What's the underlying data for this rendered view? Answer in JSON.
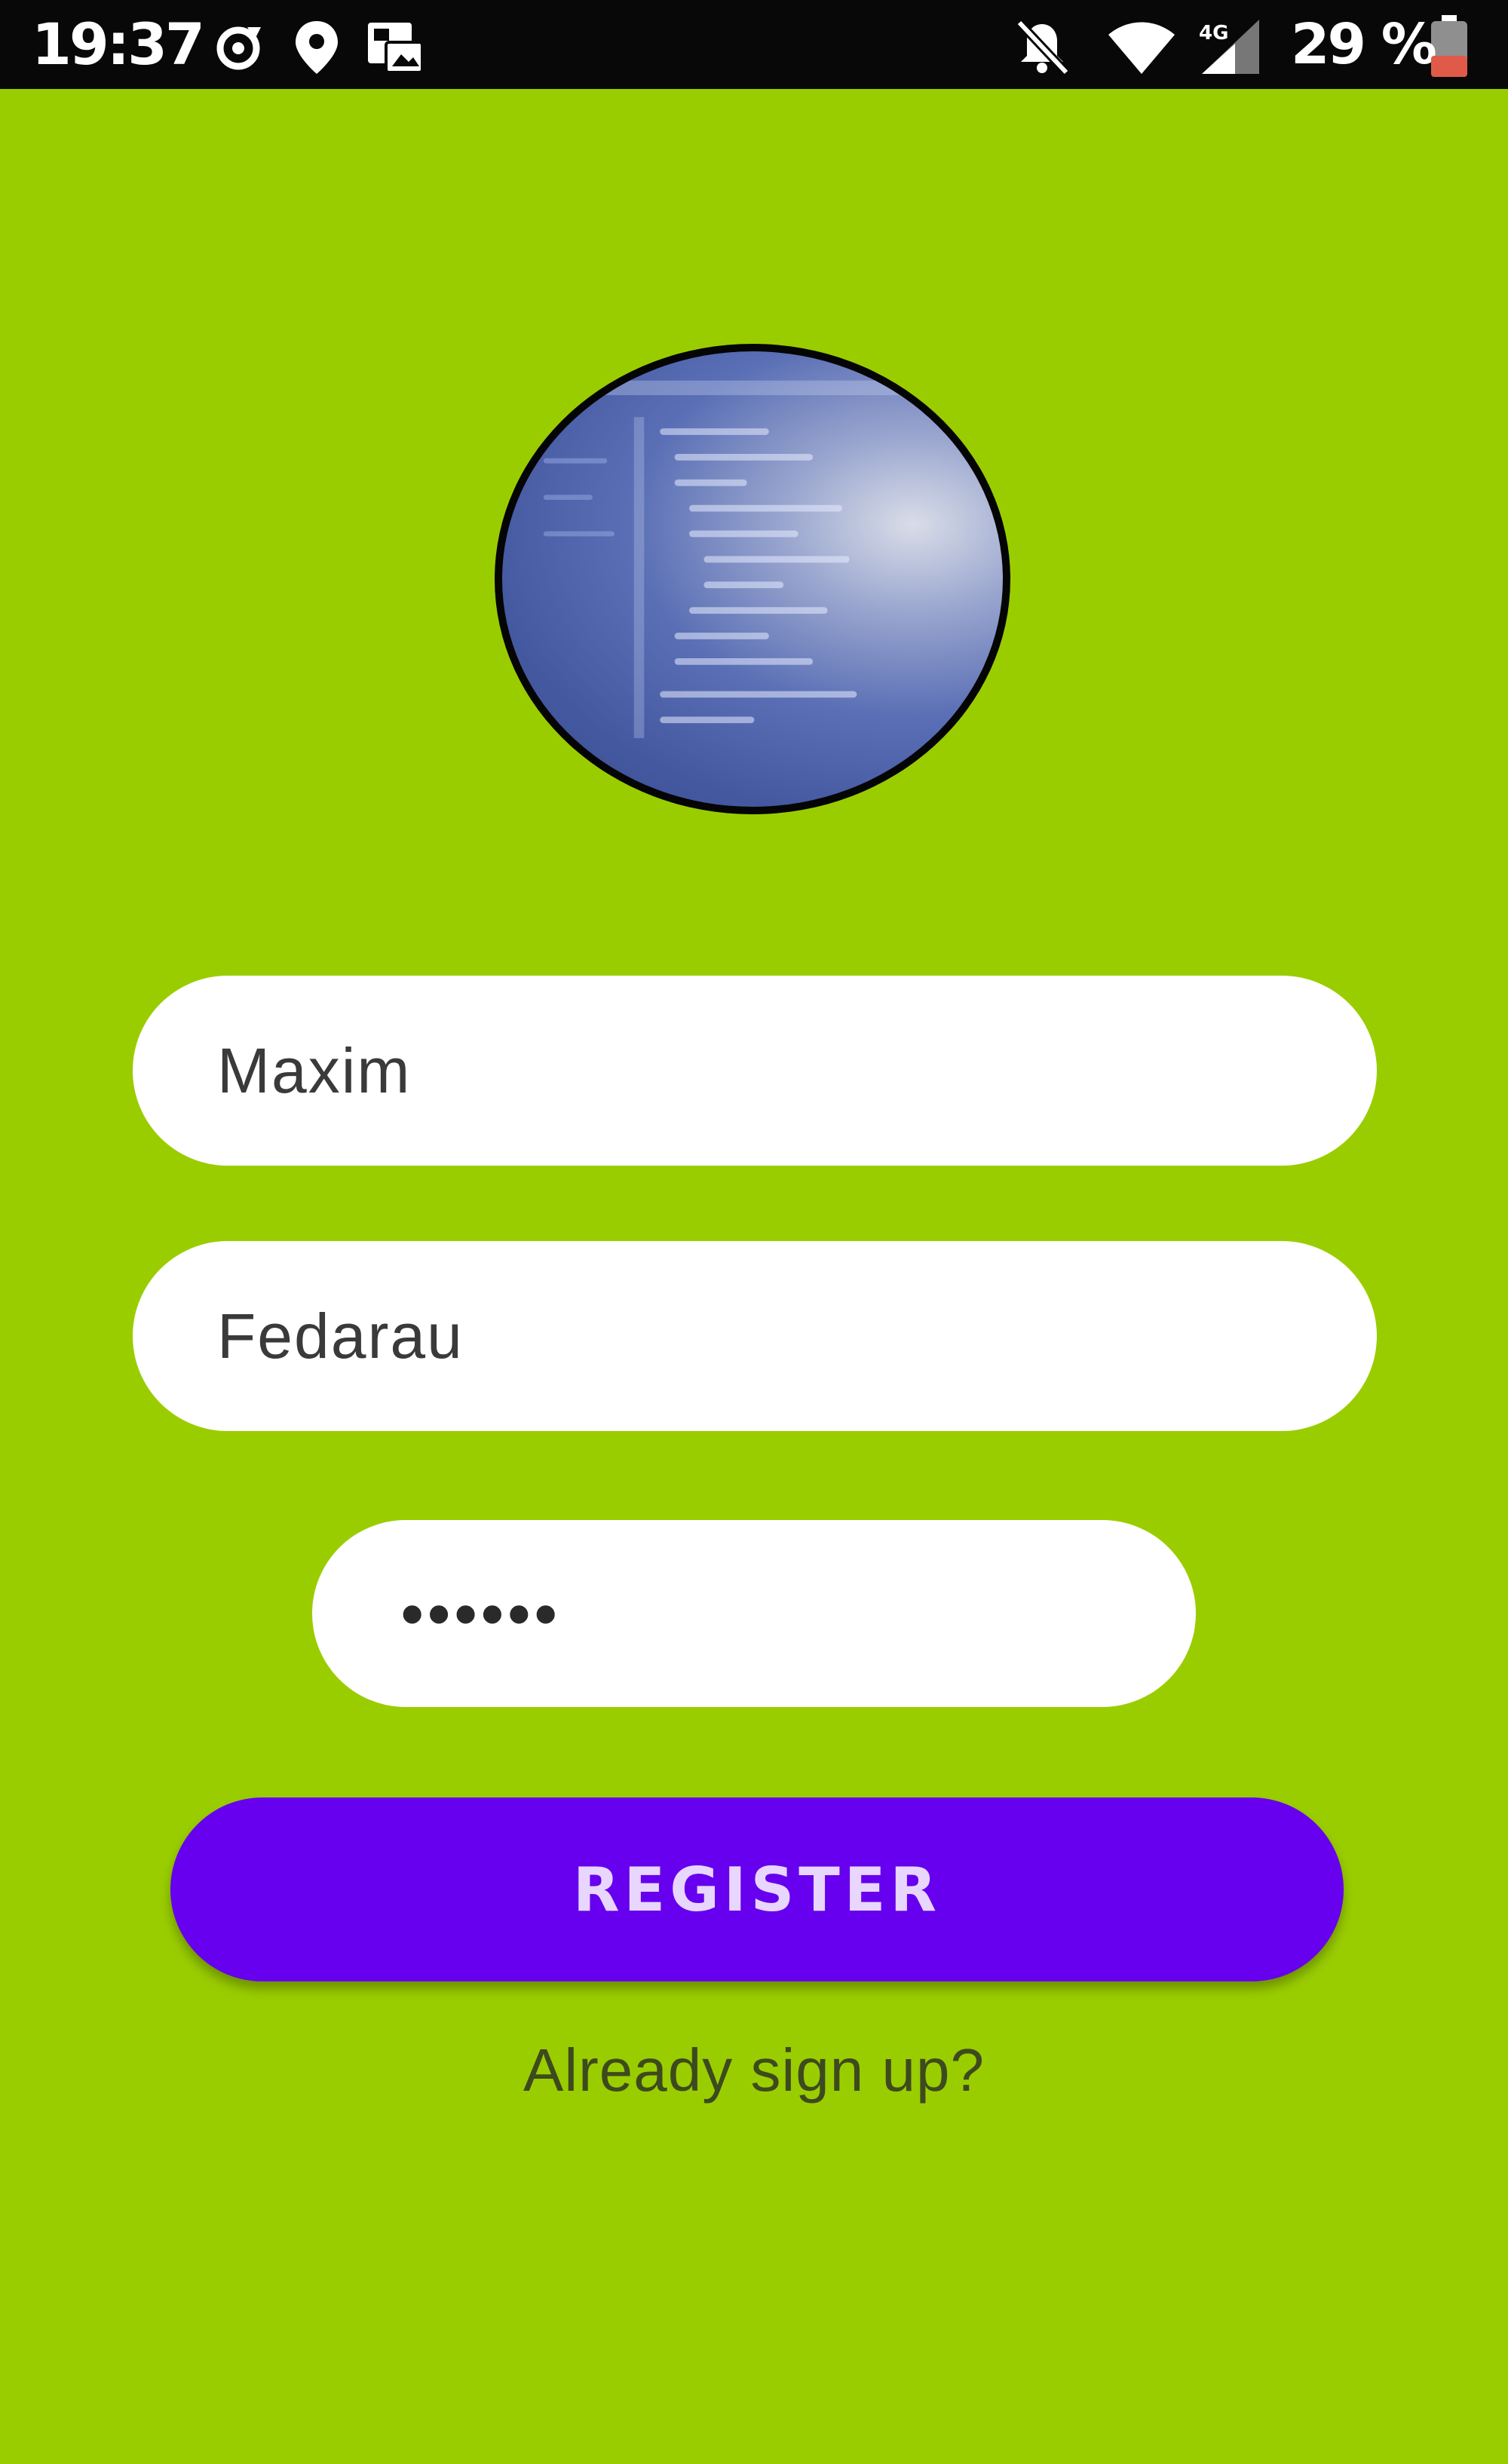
{
  "status_bar": {
    "time": "19:37",
    "battery_percent": "29 %",
    "icons": [
      "sync-icon",
      "location-icon",
      "gallery-icon",
      "mute-icon",
      "wifi-icon",
      "signal-icon",
      "battery-icon"
    ]
  },
  "colors": {
    "background": "#9ACD00",
    "status_bar": "#080808",
    "button": "#6600EE",
    "button_text": "#E8D6FF",
    "link_text": "#3d4a1e"
  },
  "avatar": {
    "icon": "code-screenshot-avatar"
  },
  "form": {
    "first_name": "Maxim",
    "last_name": "Fedarau",
    "password": "••••••"
  },
  "register_button": {
    "label": "REGISTER"
  },
  "signin_link": {
    "label": "Already sign up?"
  }
}
